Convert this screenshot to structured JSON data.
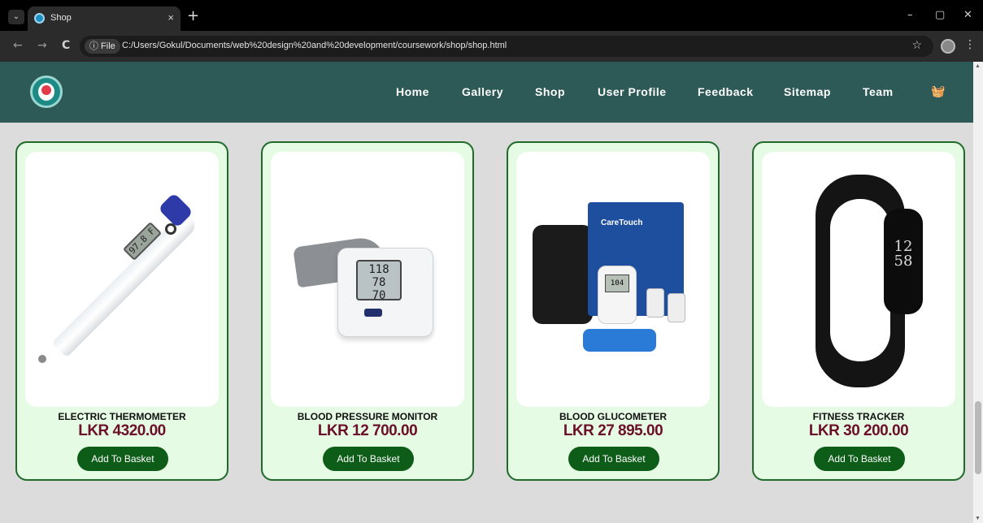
{
  "browser": {
    "tab_title": "Shop",
    "tab_close": "×",
    "new_tab": "+",
    "tab_dropdown": "⌄",
    "url_chip": "ⓘ File",
    "url": "C:/Users/Gokul/Documents/web%20design%20and%20development/coursework/shop/shop.html",
    "back_icon": "←",
    "forward_icon": "→",
    "reload_icon": "C",
    "star_icon": "☆",
    "menu_icon": "⋮",
    "minimize_icon": "–",
    "restore_icon": "▢",
    "close_icon": "✕"
  },
  "nav": {
    "links": [
      "Home",
      "Gallery",
      "Shop",
      "User Profile",
      "Feedback",
      "Sitemap",
      "Team"
    ],
    "basket_icon": "basket-icon"
  },
  "products": [
    {
      "name": "ELECTRIC THERMOMETER",
      "price": "LKR 4320.00",
      "button": "Add To Basket",
      "lcd": "97.8 F"
    },
    {
      "name": "BLOOD PRESSURE MONITOR",
      "price": "LKR 12 700.00",
      "button": "Add To Basket",
      "lcd": "118\n78\n70"
    },
    {
      "name": "BLOOD GLUCOMETER",
      "price": "LKR 27 895.00",
      "button": "Add To Basket",
      "box_brand": "CareTouch",
      "lcd": "104"
    },
    {
      "name": "FITNESS TRACKER",
      "price": "LKR 30 200.00",
      "button": "Add To Basket",
      "screen": "12\n58"
    }
  ],
  "colors": {
    "nav_bg": "#2d5a57",
    "card_bg": "#e6fbe4",
    "card_border": "#1e6b2a",
    "price": "#6b0f2a",
    "button": "#0d5c18"
  }
}
